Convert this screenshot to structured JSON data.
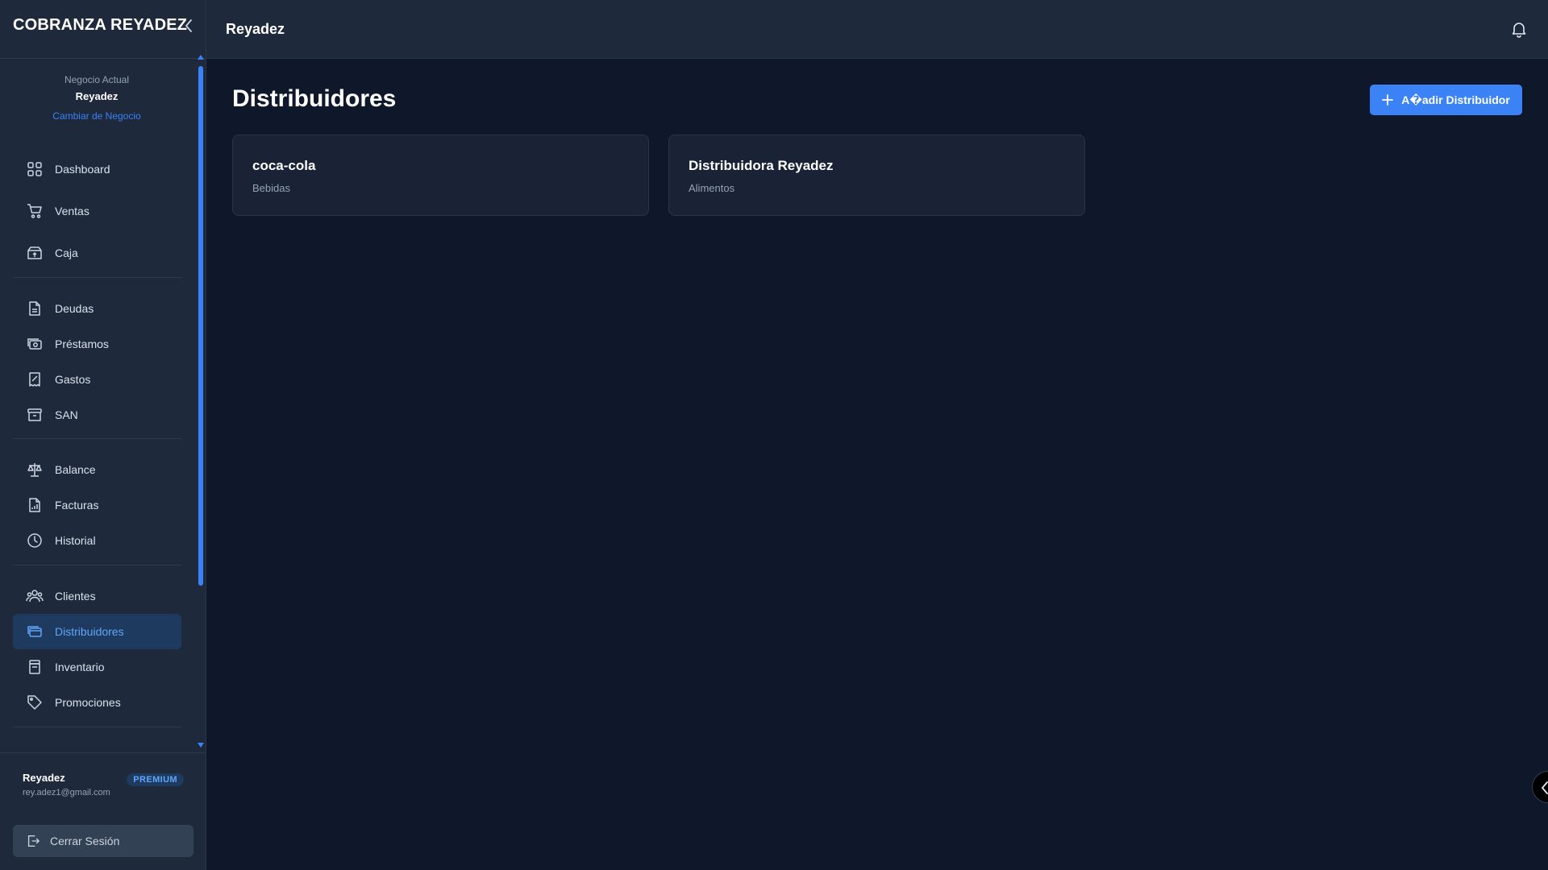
{
  "app": {
    "brand": "COBRANZA REYADEZ"
  },
  "sidebar": {
    "business_label": "Negocio Actual",
    "business_name": "Reyadez",
    "change_business": "Cambiar de Negocio",
    "groups": [
      [
        {
          "label": "Dashboard",
          "icon": "grid-icon"
        },
        {
          "label": "Ventas",
          "icon": "cart-icon"
        },
        {
          "label": "Caja",
          "icon": "cash-box-icon"
        }
      ],
      [
        {
          "label": "Deudas",
          "icon": "document-icon"
        },
        {
          "label": "Préstamos",
          "icon": "money-icon"
        },
        {
          "label": "Gastos",
          "icon": "receipt-icon"
        },
        {
          "label": "SAN",
          "icon": "archive-icon"
        }
      ],
      [
        {
          "label": "Balance",
          "icon": "scale-icon"
        },
        {
          "label": "Facturas",
          "icon": "invoice-chart-icon"
        },
        {
          "label": "Historial",
          "icon": "clock-icon"
        }
      ],
      [
        {
          "label": "Clientes",
          "icon": "users-icon"
        },
        {
          "label": "Distribuidores",
          "icon": "truck-cards-icon",
          "active": true
        },
        {
          "label": "Inventario",
          "icon": "box-icon"
        },
        {
          "label": "Promociones",
          "icon": "tag-icon"
        }
      ]
    ],
    "user": {
      "name": "Reyadez",
      "email": "rey.adez1@gmail.com",
      "plan": "PREMIUM"
    },
    "logout": "Cerrar Sesión"
  },
  "header": {
    "title": "Reyadez"
  },
  "main": {
    "title": "Distribuidores",
    "add_button": "A�adir Distribuidor",
    "distributors": [
      {
        "name": "coca-cola",
        "category": "Bebidas"
      },
      {
        "name": "Distribuidora Reyadez",
        "category": "Alimentos"
      }
    ]
  },
  "colors": {
    "accent": "#3b82f6",
    "bg": "#0f172a",
    "panel": "#1e293b",
    "active_bg": "#1e3a5f"
  }
}
